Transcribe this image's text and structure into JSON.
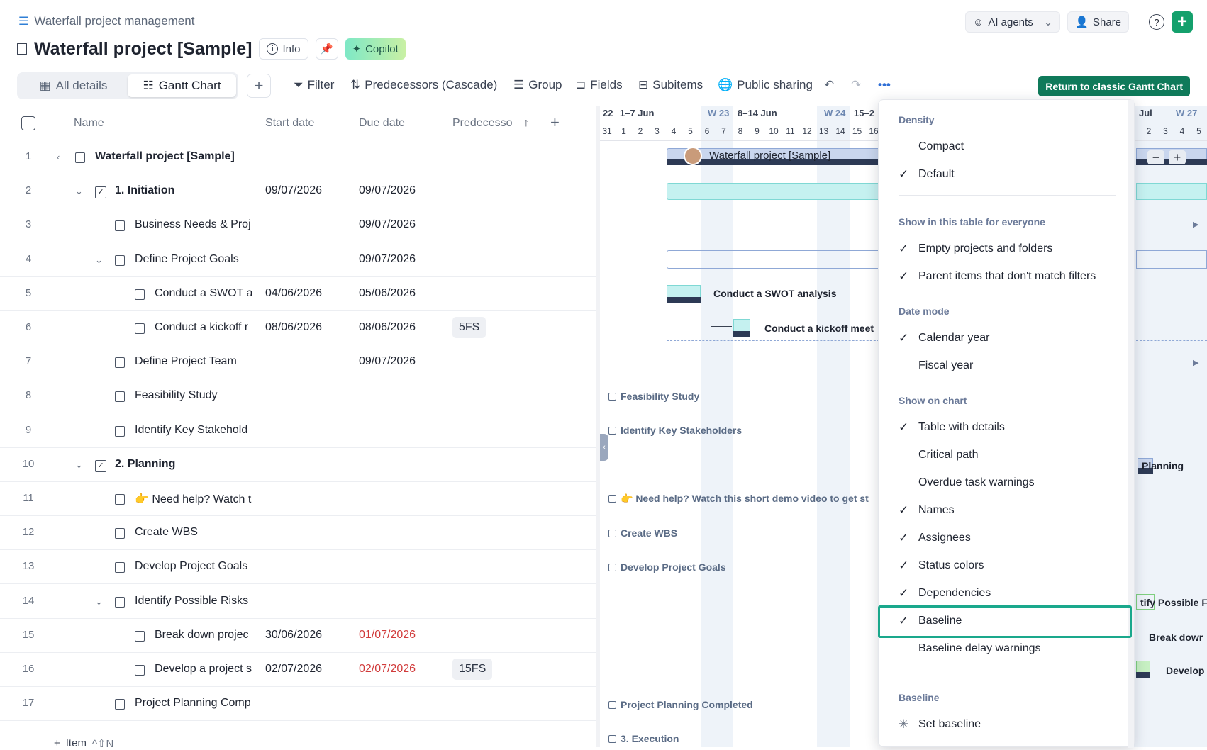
{
  "breadcrumb": {
    "label": "Waterfall project management"
  },
  "header": {
    "title": "Waterfall project [Sample]",
    "info": "Info",
    "copilot": "Copilot"
  },
  "topbar": {
    "ai_agents": "AI agents",
    "share": "Share"
  },
  "views": {
    "all_details": "All details",
    "gantt": "Gantt Chart"
  },
  "toolbar": {
    "filter": "Filter",
    "predecessors": "Predecessors (Cascade)",
    "group": "Group",
    "fields": "Fields",
    "subitems": "Subitems",
    "public_sharing": "Public sharing",
    "classic": "Return to classic Gantt Chart"
  },
  "columns": {
    "name": "Name",
    "start": "Start date",
    "due": "Due date",
    "pred": "Predecesso"
  },
  "rows": [
    {
      "num": "1",
      "name": "Waterfall project [Sample]",
      "start": "",
      "due": "",
      "pred": ""
    },
    {
      "num": "2",
      "name": "1. Initiation",
      "start": "09/07/2026",
      "due": "09/07/2026",
      "pred": ""
    },
    {
      "num": "3",
      "name": "Business Needs & Proj",
      "start": "",
      "due": "09/07/2026",
      "pred": ""
    },
    {
      "num": "4",
      "name": "Define Project Goals",
      "start": "",
      "due": "09/07/2026",
      "pred": ""
    },
    {
      "num": "5",
      "name": "Conduct a SWOT a",
      "start": "04/06/2026",
      "due": "05/06/2026",
      "pred": ""
    },
    {
      "num": "6",
      "name": "Conduct a kickoff r",
      "start": "08/06/2026",
      "due": "08/06/2026",
      "pred": "5FS"
    },
    {
      "num": "7",
      "name": "Define Project Team",
      "start": "",
      "due": "09/07/2026",
      "pred": ""
    },
    {
      "num": "8",
      "name": "Feasibility Study",
      "start": "",
      "due": "",
      "pred": ""
    },
    {
      "num": "9",
      "name": "Identify Key Stakehold",
      "start": "",
      "due": "",
      "pred": ""
    },
    {
      "num": "10",
      "name": "2. Planning",
      "start": "",
      "due": "",
      "pred": ""
    },
    {
      "num": "11",
      "name": "👉 Need help? Watch t",
      "start": "",
      "due": "",
      "pred": ""
    },
    {
      "num": "12",
      "name": "Create WBS",
      "start": "",
      "due": "",
      "pred": ""
    },
    {
      "num": "13",
      "name": "Develop Project Goals",
      "start": "",
      "due": "",
      "pred": ""
    },
    {
      "num": "14",
      "name": "Identify Possible Risks",
      "start": "",
      "due": "",
      "pred": ""
    },
    {
      "num": "15",
      "name": "Break down projec",
      "start": "30/06/2026",
      "due": "01/07/2026",
      "pred": ""
    },
    {
      "num": "16",
      "name": "Develop a project s",
      "start": "02/07/2026",
      "due": "02/07/2026",
      "pred": "15FS"
    },
    {
      "num": "17",
      "name": "Project Planning Comp",
      "start": "",
      "due": "",
      "pred": ""
    }
  ],
  "footer": {
    "add_item": "Item",
    "shortcut": "^⇧N"
  },
  "gantt": {
    "weeks": [
      "22",
      "1–7 Jun",
      "W 23",
      "8–14 Jun",
      "W 24",
      "15–2",
      "Jul",
      "W 27"
    ],
    "days": [
      "31",
      "1",
      "2",
      "3",
      "4",
      "5",
      "6",
      "7",
      "8",
      "9",
      "10",
      "11",
      "12",
      "13",
      "14",
      "15",
      "16"
    ],
    "days_right": [
      "2",
      "3",
      "4",
      "5"
    ],
    "labels": {
      "project": "Waterfall project [Sample]",
      "swot": "Conduct a SWOT analysis",
      "kickoff": "Conduct a kickoff meet",
      "feasibility": "Feasibility Study",
      "stakeholders": "Identify Key Stakeholders",
      "planning": "Planning",
      "needhelp": "👉 Need help? Watch this short demo video to get st",
      "wbs": "Create WBS",
      "goals": "Develop Project Goals",
      "risks": "tify Possible F",
      "breakdown": "Break dowr",
      "develop": "Develop",
      "completed": "Project Planning Completed",
      "execution": "3. Execution"
    }
  },
  "menu": {
    "density": "Density",
    "compact": "Compact",
    "default": "Default",
    "show_table": "Show in this table for everyone",
    "empty_projects": "Empty projects and folders",
    "parent_items": "Parent items that don't match filters",
    "date_mode": "Date mode",
    "calendar_year": "Calendar year",
    "fiscal_year": "Fiscal year",
    "show_chart": "Show on chart",
    "table_details": "Table with details",
    "critical_path": "Critical path",
    "overdue": "Overdue task warnings",
    "names": "Names",
    "assignees": "Assignees",
    "status_colors": "Status colors",
    "dependencies": "Dependencies",
    "baseline_item": "Baseline",
    "baseline_delay": "Baseline delay warnings",
    "baseline_section": "Baseline",
    "set_baseline": "Set baseline"
  },
  "colors": {
    "accent_green": "#14a06c",
    "highlight": "#1aa88c",
    "overdue": "#d13b3b"
  }
}
